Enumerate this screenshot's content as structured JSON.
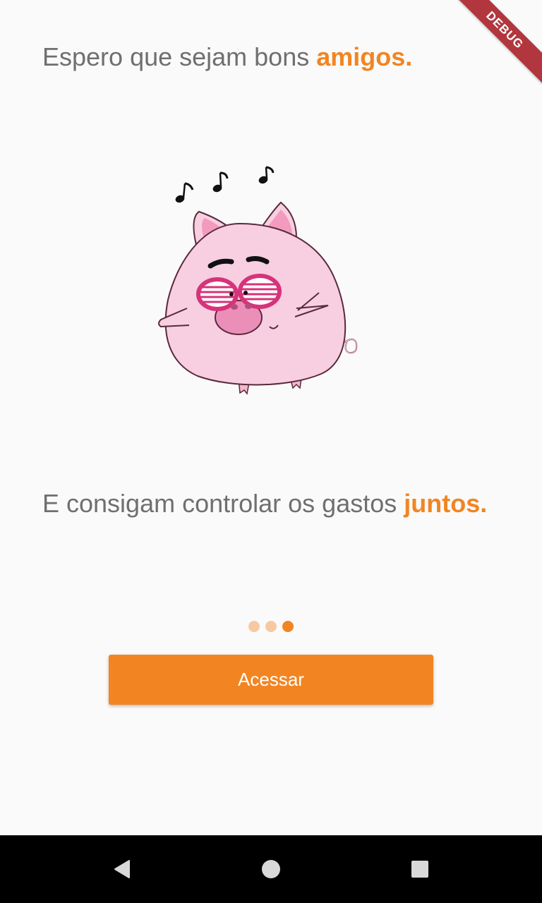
{
  "onboarding": {
    "headline_plain": "Espero que sejam bons ",
    "headline_accent": "amigos.",
    "subline_plain": "E consigam controlar os gastos ",
    "subline_accent": "juntos.",
    "illustration_icon": "dancing-pig-with-shutter-shades-icon",
    "page_indicator": {
      "total": 3,
      "current": 3
    },
    "cta_label": "Acessar"
  },
  "debug_banner": "DEBUG",
  "nav_bar": {
    "back_icon": "back-triangle-icon",
    "home_icon": "home-circle-icon",
    "recent_icon": "recent-apps-square-icon"
  },
  "colors": {
    "accent": "#f28522",
    "text": "#6f6f6f",
    "dot_inactive": "#f7c9a2",
    "background": "#fafafa",
    "pig_body": "#f7cfe1",
    "glasses": "#d6337a",
    "debug": "#b2363d"
  }
}
